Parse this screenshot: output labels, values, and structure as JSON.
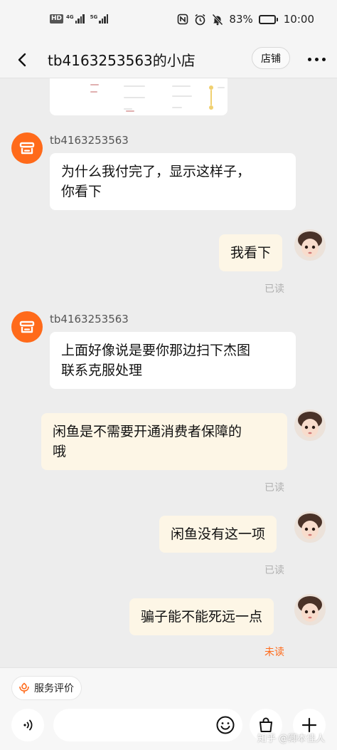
{
  "status_bar": {
    "hd_label": "HD",
    "sim1_label": "4G",
    "sim2_label": "5G",
    "battery": "83%",
    "battery_level": 0.83,
    "time": "10:00",
    "icons": [
      "nfc-icon",
      "alarm-icon",
      "mute-icon"
    ]
  },
  "header": {
    "title": "tb4163253563的小店",
    "store_button": "店铺",
    "back_icon": "chevron-left-icon",
    "more_icon": "more-dots-icon"
  },
  "messages": [
    {
      "sender": "shop",
      "name": "tb4163253563",
      "text_lines": [
        "为什么我付完了，显示这样子，",
        "你看下"
      ]
    },
    {
      "sender": "me",
      "text_lines": [
        "我看下"
      ],
      "status": "已读"
    },
    {
      "sender": "shop",
      "name": "tb4163253563",
      "text_lines": [
        "上面好像说是要你那边扫下杰图",
        "联系克服处理"
      ]
    },
    {
      "sender": "me",
      "text_lines": [
        "闲鱼是不需要开通消费者保障的",
        "哦"
      ],
      "status": "已读"
    },
    {
      "sender": "me",
      "text_lines": [
        "闲鱼没有这一项"
      ],
      "status": "已读"
    },
    {
      "sender": "me",
      "text_lines": [
        "骗子能不能死远一点"
      ],
      "status": "未读"
    }
  ],
  "bottom": {
    "service_label": "服务评价",
    "input_placeholder": "",
    "watermark": "知乎 @卿本佳人"
  },
  "colors": {
    "accent": "#ff6a1a",
    "my_bubble": "#fdf6e6",
    "their_bubble": "#ffffff",
    "background": "#ededed",
    "read_text": "#b0b0b0"
  }
}
